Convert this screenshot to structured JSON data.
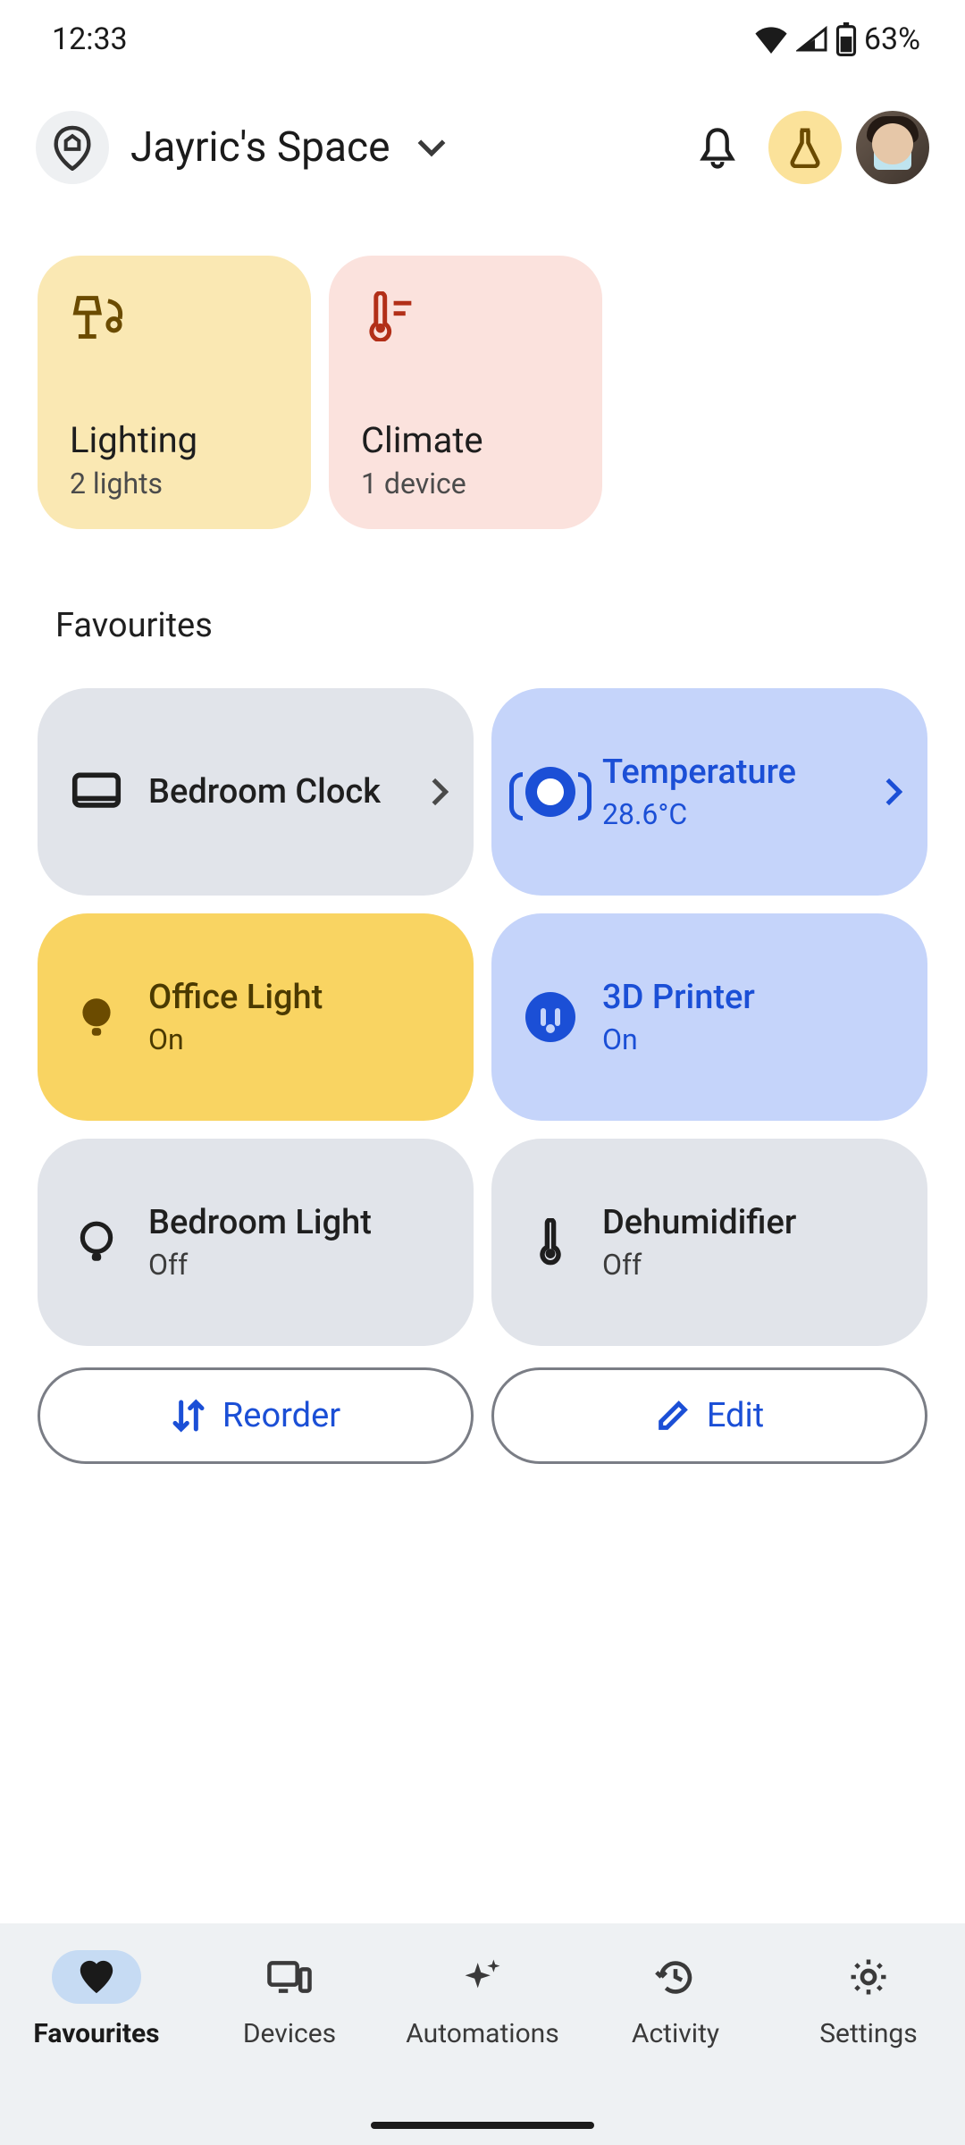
{
  "status": {
    "time": "12:33",
    "battery_pct": "63%"
  },
  "header": {
    "space_name": "Jayric's Space"
  },
  "categories": {
    "lighting": {
      "title": "Lighting",
      "subtitle": "2 lights"
    },
    "climate": {
      "title": "Climate",
      "subtitle": "1 device"
    }
  },
  "favourites_heading": "Favourites",
  "tiles": {
    "bedroom_clock": {
      "title": "Bedroom Clock"
    },
    "temperature": {
      "title": "Temperature",
      "subtitle": "28.6°C"
    },
    "office_light": {
      "title": "Office Light",
      "subtitle": "On"
    },
    "printer_3d": {
      "title": "3D Printer",
      "subtitle": "On"
    },
    "bedroom_light": {
      "title": "Bedroom Light",
      "subtitle": "Off"
    },
    "dehumidifier": {
      "title": "Dehumidifier",
      "subtitle": "Off"
    }
  },
  "actions": {
    "reorder": "Reorder",
    "edit": "Edit"
  },
  "nav": {
    "favourites": "Favourites",
    "devices": "Devices",
    "automations": "Automations",
    "activity": "Activity",
    "settings": "Settings"
  }
}
